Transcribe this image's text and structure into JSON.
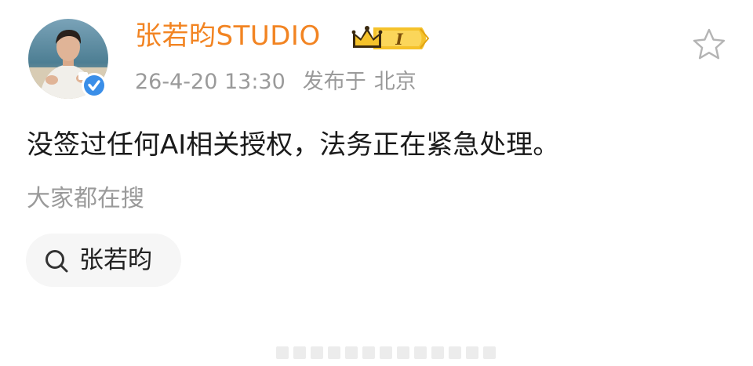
{
  "post": {
    "author": {
      "name": "张若昀STUDIO",
      "avatar_alt": "avatar",
      "verified_icon": "verified-check-icon",
      "badge_icon": "crown-vip-badge",
      "badge_text": "I"
    },
    "date": "26-4-20 13:30",
    "published_label": "发布于",
    "location": "北京",
    "favorite_icon": "star-outline-icon",
    "content": "没签过任何AI相关授权，法务正在紧急处理。"
  },
  "trending": {
    "label": "大家都在搜",
    "search_icon": "search-icon",
    "chips": [
      {
        "label": "张若昀"
      }
    ]
  },
  "colors": {
    "username": "#f28422",
    "meta": "#9a9a9a",
    "body_text": "#1a1a1a",
    "chip_bg": "#f6f6f6",
    "verified_blue": "#3a8ee8",
    "badge_gold": "#f5c22b"
  }
}
